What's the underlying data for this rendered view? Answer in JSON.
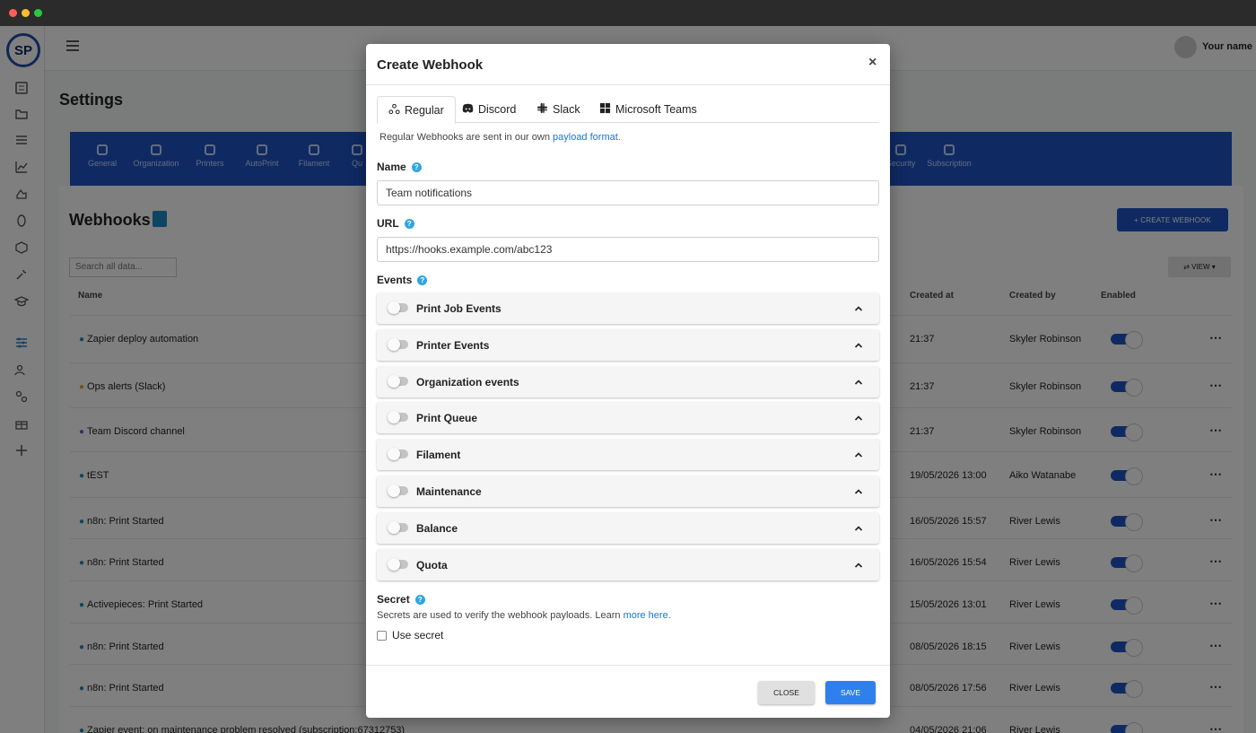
{
  "app": {
    "logo_text": "SP",
    "user_name": "Your name",
    "page_title": "Settings",
    "settings_tabs": [
      "General",
      "Organization",
      "Printers",
      "AutoPrint",
      "Filament",
      "Qu",
      "Security",
      "Subscription"
    ]
  },
  "webhooks_page": {
    "title": "Webhooks",
    "create_label": "+ CREATE WEBHOOK",
    "search_placeholder": "Search all data...",
    "view_label": "⇄ VIEW ▾",
    "columns": {
      "name": "Name",
      "created_at": "Created at",
      "created_by": "Created by",
      "enabled": "Enabled"
    },
    "rows": [
      {
        "name": "Zapier deploy automation",
        "created_at": "21:37",
        "created_by": "Skyler Robinson"
      },
      {
        "name": "Ops alerts (Slack)",
        "created_at": "21:37",
        "created_by": "Skyler Robinson"
      },
      {
        "name": "Team Discord channel",
        "created_at": "21:37",
        "created_by": "Skyler Robinson"
      },
      {
        "name": "tEST",
        "created_at": "19/05/2026 13:00",
        "created_by": "Aiko Watanabe"
      },
      {
        "name": "n8n: Print Started",
        "created_at": "16/05/2026 15:57",
        "created_by": "River Lewis"
      },
      {
        "name": "n8n: Print Started",
        "created_at": "16/05/2026 15:54",
        "created_by": "River Lewis"
      },
      {
        "name": "Activepieces: Print Started",
        "created_at": "15/05/2026 13:01",
        "created_by": "River Lewis"
      },
      {
        "name": "n8n: Print Started",
        "created_at": "08/05/2026 18:15",
        "created_by": "River Lewis"
      },
      {
        "name": "n8n: Print Started",
        "created_at": "08/05/2026 17:56",
        "created_by": "River Lewis"
      },
      {
        "name": "Zapier event: on maintenance problem resolved (subscription:67312753)",
        "created_at": "04/05/2026 21:06",
        "created_by": "River Lewis"
      }
    ]
  },
  "modal": {
    "title": "Create Webhook",
    "close_icon": "×",
    "tabs": [
      "Regular",
      "Discord",
      "Slack",
      "Microsoft Teams"
    ],
    "info_text": "Regular Webhooks are sent in our own ",
    "info_link": "payload format.",
    "name_label": "Name",
    "name_value": "Team notifications",
    "url_label": "URL",
    "url_value": "https://hooks.example.com/abc123",
    "events_label": "Events",
    "events": [
      "Print Job Events",
      "Printer Events",
      "Organization events",
      "Print Queue",
      "Filament",
      "Maintenance",
      "Balance",
      "Quota"
    ],
    "secret_label": "Secret",
    "secret_info": "Secrets are used to verify the webhook payloads. Learn ",
    "secret_link": "more here.",
    "use_secret_label": "Use secret",
    "close_button": "CLOSE",
    "save_button": "SAVE",
    "help_glyph": "?"
  }
}
